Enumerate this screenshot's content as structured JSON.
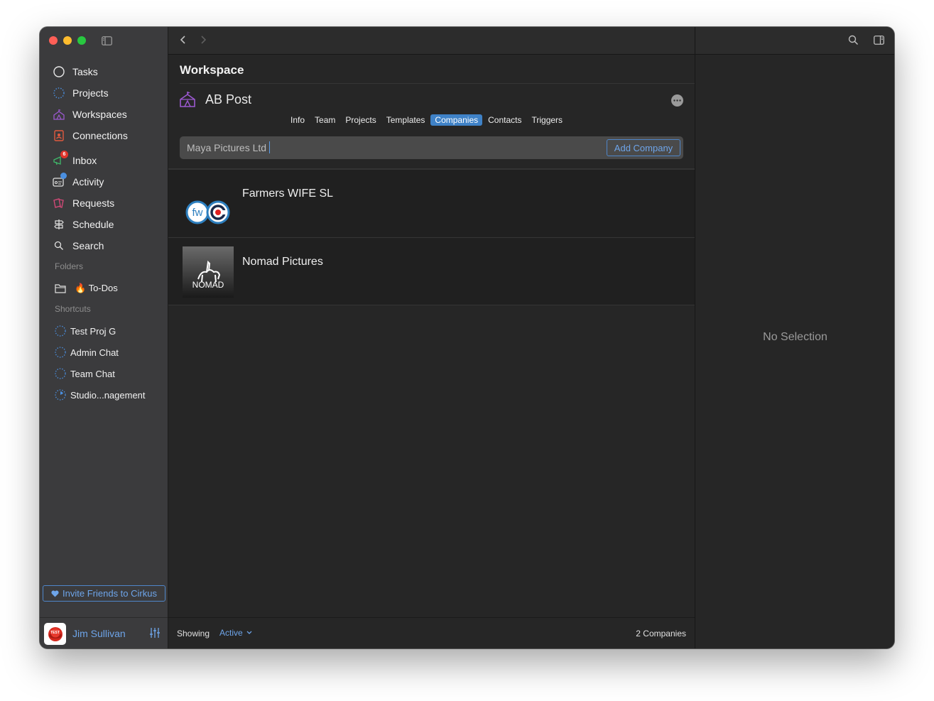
{
  "sidebar": {
    "nav": [
      {
        "label": "Tasks",
        "icon": "circle-icon"
      },
      {
        "label": "Projects",
        "icon": "dotted-circle-icon"
      },
      {
        "label": "Workspaces",
        "icon": "tent-icon"
      },
      {
        "label": "Connections",
        "icon": "contact-book-icon"
      },
      {
        "label": "Inbox",
        "icon": "megaphone-icon",
        "badge": "6"
      },
      {
        "label": "Activity",
        "icon": "activity-icon"
      },
      {
        "label": "Requests",
        "icon": "requests-icon"
      },
      {
        "label": "Schedule",
        "icon": "signpost-icon"
      },
      {
        "label": "Search",
        "icon": "search-icon"
      }
    ],
    "folders_title": "Folders",
    "folders": [
      {
        "label": "🔥 To-Dos",
        "icon": "folder-icon"
      }
    ],
    "shortcuts_title": "Shortcuts",
    "shortcuts": [
      {
        "label": "Test Proj G"
      },
      {
        "label": "Admin Chat"
      },
      {
        "label": "Team Chat"
      },
      {
        "label": "Studio...nagement"
      }
    ],
    "invite_label": "Invite Friends to Cirkus",
    "user_name": "Jim Sullivan",
    "avatar_text": "TEST"
  },
  "main": {
    "title": "Workspace",
    "workspace_name": "AB Post",
    "tabs": [
      {
        "label": "Info"
      },
      {
        "label": "Team"
      },
      {
        "label": "Projects"
      },
      {
        "label": "Templates"
      },
      {
        "label": "Companies",
        "active": true
      },
      {
        "label": "Contacts"
      },
      {
        "label": "Triggers"
      }
    ],
    "search_value": "Maya Pictures Ltd",
    "add_company_label": "Add Company",
    "companies": [
      {
        "name": "Farmers WIFE SL",
        "logo_text": "fw"
      },
      {
        "name": "Nomad Pictures",
        "logo_text": "NOMAD"
      }
    ],
    "footer": {
      "showing_label": "Showing",
      "filter_value": "Active",
      "count_label": "2 Companies"
    }
  },
  "detail": {
    "empty_label": "No Selection"
  },
  "colors": {
    "accent": "#3f82c7",
    "link": "#6ea5ea",
    "badge_red": "#e0352b"
  }
}
